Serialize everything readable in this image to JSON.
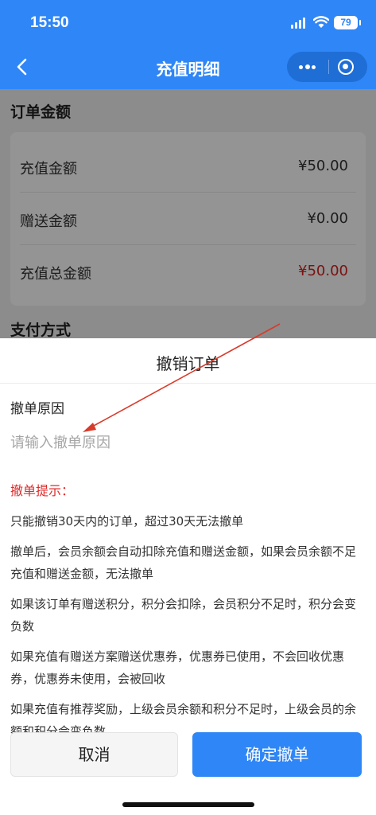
{
  "status_bar": {
    "time": "15:50",
    "battery": "79"
  },
  "nav": {
    "title": "充值明细"
  },
  "order_amount": {
    "title": "订单金额",
    "rows": [
      {
        "label": "充值金额",
        "value": "¥50.00"
      },
      {
        "label": "赠送金额",
        "value": "¥0.00"
      },
      {
        "label": "充值总金额",
        "value": "¥50.00"
      }
    ]
  },
  "payment": {
    "title": "支付方式"
  },
  "dialog": {
    "title": "撤销订单",
    "reason_label": "撤单原因",
    "reason_placeholder": "请输入撤单原因",
    "reason_value": "",
    "tips_title": "撤单提示：",
    "tips": [
      "只能撤销30天内的订单，超过30天无法撤单",
      "撤单后，会员余额会自动扣除充值和赠送金额，如果会员余额不足充值和赠送金额，无法撤单",
      "如果该订单有赠送积分，积分会扣除，会员积分不足时，积分会变负数",
      "如果充值有赠送方案赠送优惠券，优惠券已使用，不会回收优惠券，优惠券未使用，会被回收",
      "如果充值有推荐奖励，上级会员余额和积分不足时，上级会员的余额和积分会变负数"
    ],
    "cancel_label": "取消",
    "confirm_label": "确定撤单"
  },
  "colors": {
    "primary": "#2f86f6",
    "danger": "#e02a2a",
    "annotation_arrow": "#d93a2a"
  }
}
